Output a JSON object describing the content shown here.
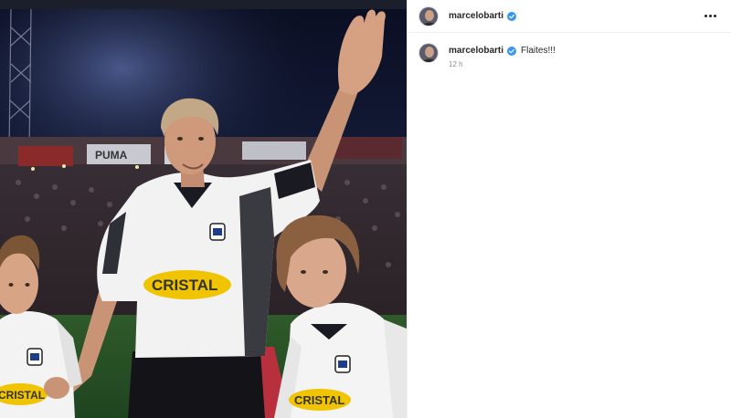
{
  "post": {
    "author": {
      "username": "marcelobarti",
      "verified": true,
      "avatar_icon": "profile-avatar"
    },
    "caption": "Flaites!!!",
    "timestamp": "12 h",
    "options_icon": "more-horizontal-icon",
    "verified_icon": "verified-badge-icon",
    "verified_color": "#3897f0"
  },
  "photo": {
    "jersey_sponsor": "CRISTAL",
    "stadium_banner": "PUMA"
  }
}
